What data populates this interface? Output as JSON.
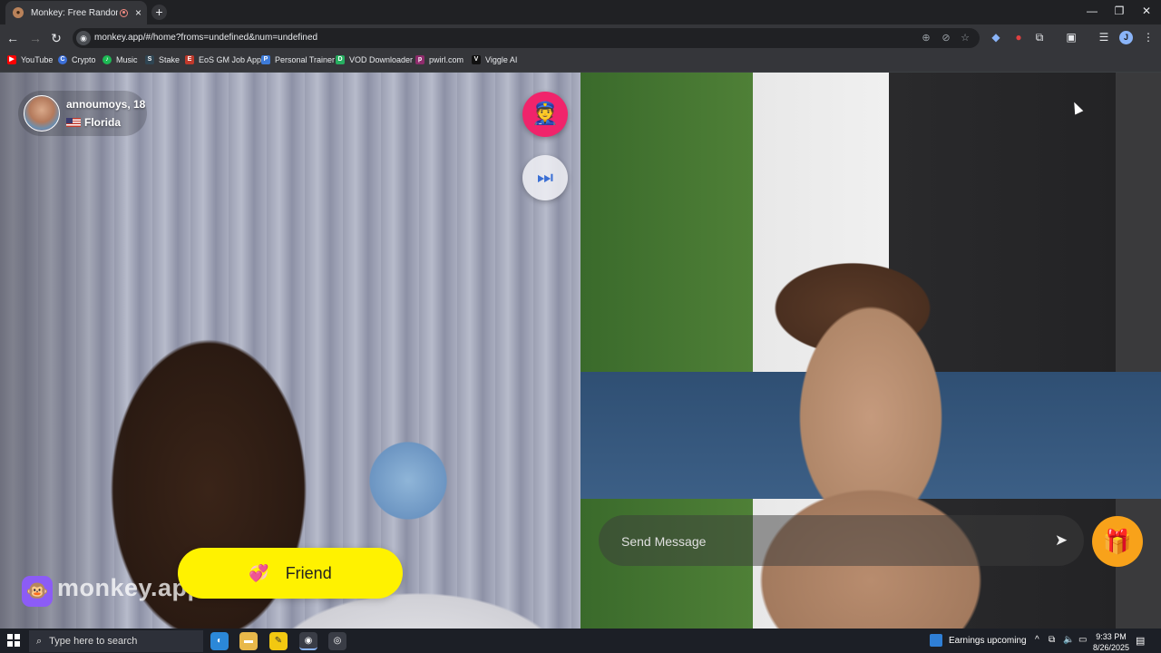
{
  "browser": {
    "tab_title": "Monkey: Free Random Vide",
    "favicon_glyph": "●",
    "tab_close": "×",
    "new_tab": "+",
    "window_controls": {
      "minimize": "—",
      "restore": "❐",
      "close": "✕"
    },
    "nav": {
      "back": "←",
      "forward": "→",
      "reload": "↻"
    },
    "site_icon_glyph": "◉",
    "url": "monkey.app/#/home?froms=undefined&num=undefined",
    "omnibox_icons": {
      "zoom": "⊕",
      "eye_off": "⊘",
      "star": "☆"
    },
    "extension_icons": [
      "◆",
      "●",
      "⧉",
      "▣",
      "☰"
    ],
    "profile_initial": "J",
    "menu": "⋮"
  },
  "bookmarks": [
    {
      "label": "YouTube",
      "color": "#ff0000",
      "glyph": "▶"
    },
    {
      "label": "Crypto",
      "color": "#3c6fd8",
      "glyph": "C"
    },
    {
      "label": "Music",
      "color": "#1db954",
      "glyph": "♪"
    },
    {
      "label": "Stake",
      "color": "#2f4553",
      "glyph": "S"
    },
    {
      "label": "EoS GM Job App",
      "color": "#c0392b",
      "glyph": "E"
    },
    {
      "label": "Personal Trainer",
      "color": "#3d7bd9",
      "glyph": "P"
    },
    {
      "label": "VOD Downloader",
      "color": "#27ae60",
      "glyph": "D"
    },
    {
      "label": "pwirl.com",
      "color": "#8e2c6c",
      "glyph": "p"
    },
    {
      "label": "Viggle AI",
      "color": "#111111",
      "glyph": "V"
    }
  ],
  "partner": {
    "name_age": "annoumoys, 18",
    "location": "Florida"
  },
  "controls": {
    "report_glyph": "👮",
    "skip_glyph": "⏭",
    "logo_glyph": "🐵",
    "logo_text": "monkey.app",
    "friend_heart": "💞",
    "friend_label": "Friend",
    "message_placeholder": "Send Message",
    "send_glyph": "➤",
    "gift_glyph": "🎁"
  },
  "taskbar": {
    "search_placeholder": "Type here to search",
    "search_glyph": "⌕",
    "apps": [
      {
        "glyph": "◐",
        "color": "#2b88d8"
      },
      {
        "glyph": "▬",
        "color": "#e8b84a"
      },
      {
        "glyph": "✎",
        "color": "#f2c811"
      },
      {
        "glyph": "◉",
        "color": "#3a3d46"
      },
      {
        "glyph": "◎",
        "color": "#3a3d46"
      }
    ],
    "news_label": "Earnings upcoming",
    "tray_icons": [
      "^",
      "⧉",
      "🔈",
      "▭"
    ],
    "time": "9:33 PM",
    "date": "8/26/2025",
    "notification_glyph": "▤"
  }
}
